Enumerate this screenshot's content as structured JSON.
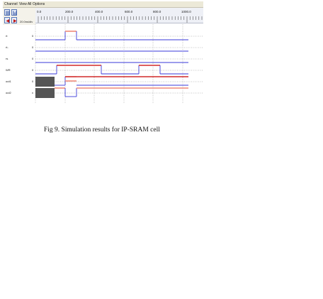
{
  "menu": {
    "items": [
      "Channel",
      "View All",
      "Options"
    ]
  },
  "toolbar": {
    "scale_label": "20.0ns/div"
  },
  "ruler": {
    "ticks": [
      "0.0",
      "200.0",
      "400.0",
      "600.0",
      "800.0",
      "1000.0"
    ]
  },
  "signals": [
    {
      "name": "rt",
      "value": "0"
    },
    {
      "name": "rt-",
      "value": "0"
    },
    {
      "name": "rs",
      "value": "0"
    },
    {
      "name": "WR",
      "value": "0"
    },
    {
      "name": "out1",
      "value": "0"
    },
    {
      "name": "out2",
      "value": "x"
    }
  ],
  "colors": {
    "low": "#3a3ad8",
    "high": "#d22a2a",
    "high_edge": "#f08a7a",
    "grid": "#8c8c8c",
    "unknown": "#555555"
  },
  "caption": "Fig 9. Simulation results for IP-SRAM cell"
}
